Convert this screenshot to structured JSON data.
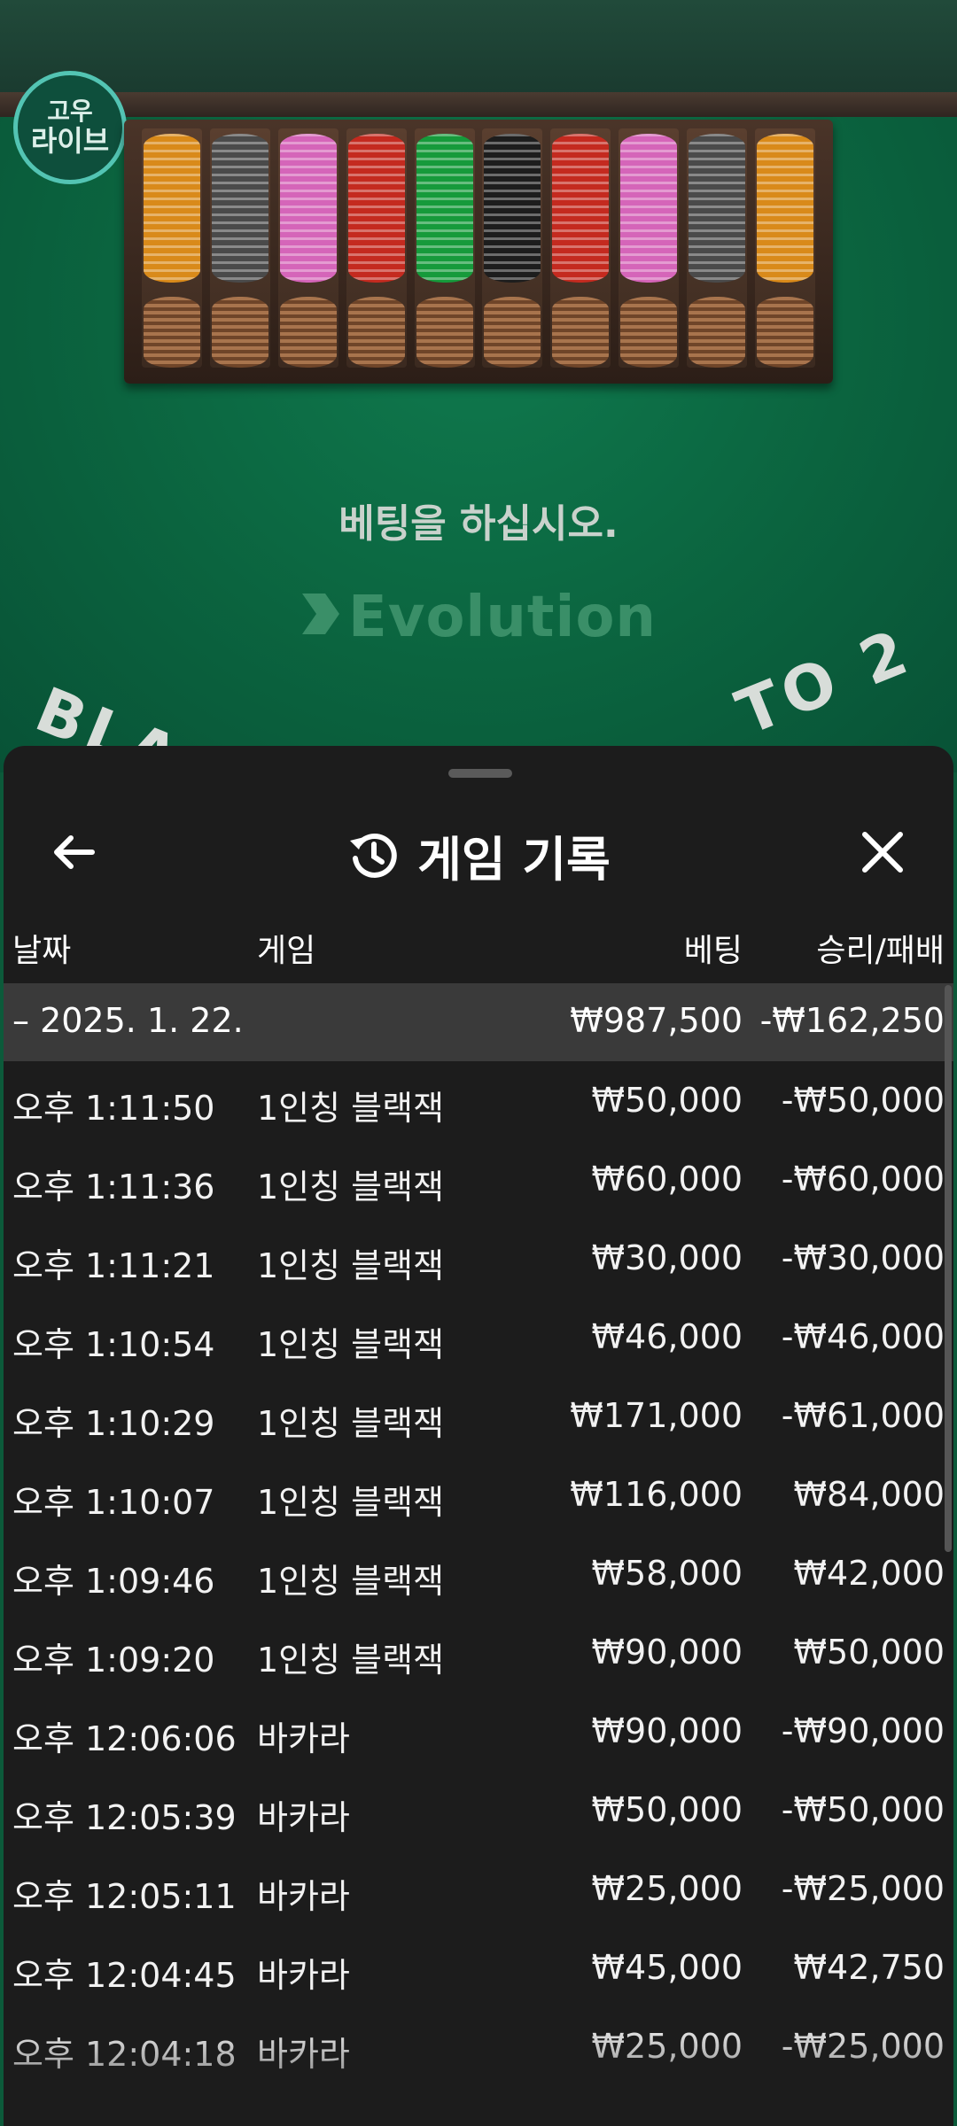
{
  "logo": {
    "line1": "고우",
    "line2": "라이브"
  },
  "table": {
    "bet_message": "베팅을 하십시오.",
    "brand": "Evolution",
    "arc_left": "BLAC",
    "arc_right": "TO 2"
  },
  "chips": [
    "#d98a1a",
    "#4a4a4a",
    "#d565b9",
    "#c42a1f",
    "#169a3b",
    "#1d1d1d",
    "#c42a1f",
    "#d565b9",
    "#4a4a4a",
    "#d98a1a"
  ],
  "panel": {
    "title": "게임 기록",
    "columns": {
      "date": "날짜",
      "game": "게임",
      "bet": "베팅",
      "result": "승리/패배"
    },
    "date_group": {
      "date": "– 2025. 1. 22.",
      "bet": "₩987,500",
      "result": "-₩162,250"
    },
    "rows": [
      {
        "time": "오후 1:11:50",
        "game": "1인칭 블랙잭",
        "bet": "₩50,000",
        "result": "-₩50,000"
      },
      {
        "time": "오후 1:11:36",
        "game": "1인칭 블랙잭",
        "bet": "₩60,000",
        "result": "-₩60,000"
      },
      {
        "time": "오후 1:11:21",
        "game": "1인칭 블랙잭",
        "bet": "₩30,000",
        "result": "-₩30,000"
      },
      {
        "time": "오후 1:10:54",
        "game": "1인칭 블랙잭",
        "bet": "₩46,000",
        "result": "-₩46,000"
      },
      {
        "time": "오후 1:10:29",
        "game": "1인칭 블랙잭",
        "bet": "₩171,000",
        "result": "-₩61,000"
      },
      {
        "time": "오후 1:10:07",
        "game": "1인칭 블랙잭",
        "bet": "₩116,000",
        "result": "₩84,000"
      },
      {
        "time": "오후 1:09:46",
        "game": "1인칭 블랙잭",
        "bet": "₩58,000",
        "result": "₩42,000"
      },
      {
        "time": "오후 1:09:20",
        "game": "1인칭 블랙잭",
        "bet": "₩90,000",
        "result": "₩50,000"
      },
      {
        "time": "오후 12:06:06",
        "game": "바카라",
        "bet": "₩90,000",
        "result": "-₩90,000"
      },
      {
        "time": "오후 12:05:39",
        "game": "바카라",
        "bet": "₩50,000",
        "result": "-₩50,000"
      },
      {
        "time": "오후 12:05:11",
        "game": "바카라",
        "bet": "₩25,000",
        "result": "-₩25,000"
      },
      {
        "time": "오후 12:04:45",
        "game": "바카라",
        "bet": "₩45,000",
        "result": "₩42,750"
      },
      {
        "time": "오후 12:04:18",
        "game": "바카라",
        "bet": "₩25,000",
        "result": "-₩25,000"
      }
    ]
  }
}
